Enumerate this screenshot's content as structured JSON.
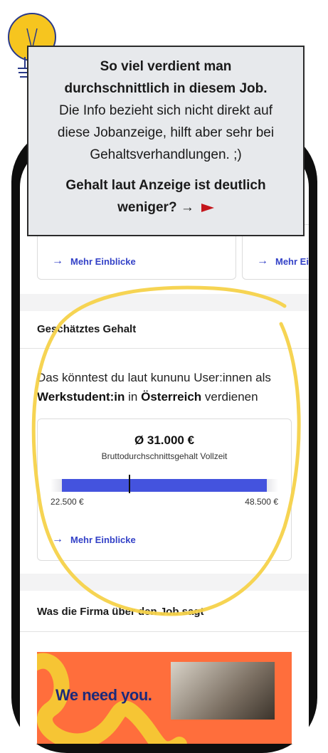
{
  "tooltip": {
    "title_line1": "So viel verdient man",
    "title_line2": "durchschnittlich in diesem Job.",
    "body_line1": "Die Info bezieht sich nicht direkt auf",
    "body_line2": "diese Jobanzeige, hilft aber sehr bei",
    "body_line3": "Gehaltsverhandlungen. ;)",
    "cta_line1": "Gehalt laut Anzeige ist deutlich",
    "cta_line2": "weniger? →"
  },
  "insights_row": {
    "link_label": "Mehr Einblicke",
    "link_label_partial": "Mehr Ei"
  },
  "salary": {
    "section_title": "Geschätztes Gehalt",
    "intro_prefix": "Das könntest du laut kununu User:innen als",
    "job_title": "Werkstudent:in",
    "intro_in": "in",
    "country": "Österreich",
    "intro_suffix": "verdienen",
    "average": "Ø 31.000 €",
    "average_caption": "Bruttodurchschnittsgehalt Vollzeit",
    "min_label": "22.500 €",
    "max_label": "48.500 €",
    "range_min": 22500,
    "range_max": 48500,
    "average_value": 31000,
    "link_label": "Mehr Einblicke"
  },
  "company": {
    "section_title": "Was die Firma über den Job sagt",
    "banner_text": "We need you."
  },
  "colors": {
    "accent_blue": "#3341c7",
    "bar_blue": "#4453de",
    "banner_orange": "#ff6e3c",
    "highlight_yellow": "#f6d24a",
    "flag_red": "#c4161c"
  }
}
